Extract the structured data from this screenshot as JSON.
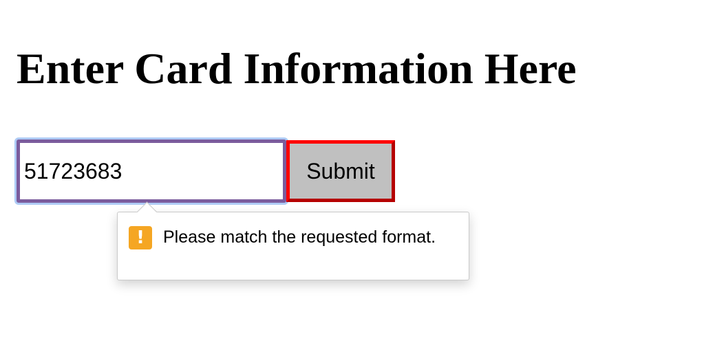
{
  "page": {
    "title": "Enter Card Information Here"
  },
  "form": {
    "card_value": "51723683",
    "submit_label": "Submit"
  },
  "validation": {
    "icon": "warning-icon",
    "icon_glyph": "!",
    "message": "Please match the requested format."
  }
}
